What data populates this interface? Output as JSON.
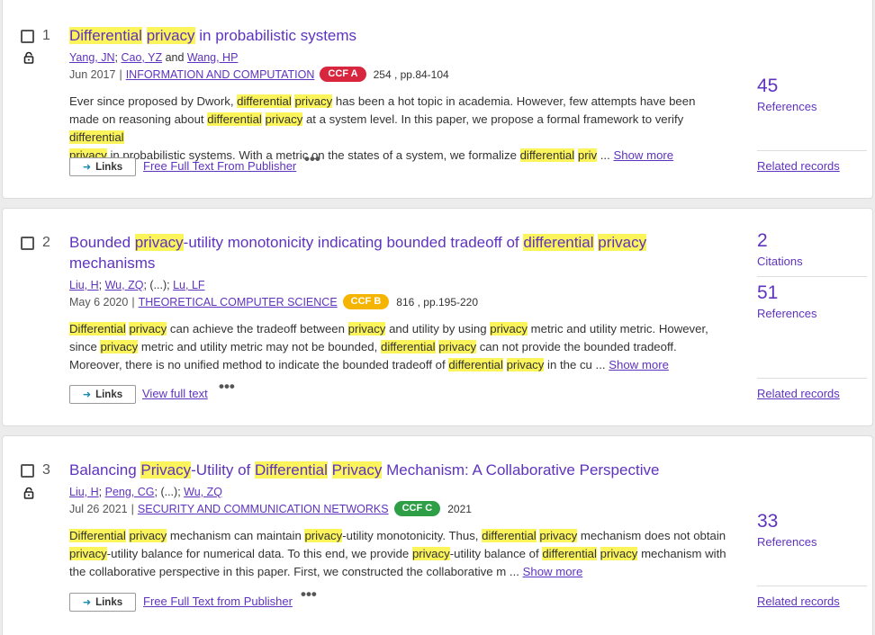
{
  "results": [
    {
      "index": "1",
      "title_parts": [
        "Differential",
        " ",
        "privacy",
        " in probabilistic systems"
      ],
      "authors": [
        "Yang, JN",
        "Cao, YZ",
        "Wang, HP"
      ],
      "author_sep1": ";",
      "author_and": "and",
      "date": "Jun 2017",
      "journal": "INFORMATION AND COMPUTATION",
      "ccf": "CCF A",
      "ccf_color": "#d7263d",
      "volume": "254 , pp.84-104",
      "abstract_parts": [
        "Ever since proposed by Dwork, ",
        "differential",
        " ",
        "privacy",
        " has been a hot topic in academia. However, few attempts have been made on reasoning about ",
        "differential",
        " ",
        "privacy",
        " at a system level. In this paper, we propose a formal framework to verify ",
        "differential",
        " ",
        "privacy",
        " in probabilistic systems. With a metric on the states of a system, we formalize ",
        "differential",
        " ",
        "priv",
        " ... "
      ],
      "show_more": "Show more",
      "links_label": "Links",
      "fulltext": "Free Full Text From Publisher",
      "stats": [
        {
          "num": "45",
          "label": "References"
        }
      ],
      "related": "Related records",
      "locked": true
    },
    {
      "index": "2",
      "title_parts": [
        "Bounded ",
        "privacy",
        "-utility monotonicity indicating bounded tradeoff of ",
        "differential",
        " ",
        "privacy",
        " mechanisms"
      ],
      "authors": [
        "Liu, H",
        "Wu, ZQ",
        "Lu, LF"
      ],
      "author_mid": "; (...);",
      "date": "May 6 2020",
      "journal": "THEORETICAL COMPUTER SCIENCE",
      "ccf": "CCF B",
      "ccf_color": "#f5b400",
      "volume": "816 , pp.195-220",
      "abstract_parts": [
        "Differential",
        " ",
        "privacy",
        " can achieve the tradeoff between ",
        "privacy",
        " and utility by using ",
        "privacy",
        " metric and utility metric. However, since ",
        "privacy",
        " metric and utility metric may not be bounded, ",
        "differential",
        " ",
        "privacy",
        " can not provide the bounded tradeoff. Moreover, there is no unified method to indicate the bounded tradeoff of ",
        "differential",
        " ",
        "privacy",
        " in the cu ... "
      ],
      "show_more": "Show more",
      "links_label": "Links",
      "fulltext": "View full text",
      "stats": [
        {
          "num": "2",
          "label": "Citations"
        },
        {
          "num": "51",
          "label": "References"
        }
      ],
      "related": "Related records",
      "locked": false
    },
    {
      "index": "3",
      "title_parts": [
        "Balancing ",
        "Privacy",
        "-Utility of ",
        "Differential",
        " ",
        "Privacy",
        " Mechanism: A Collaborative Perspective"
      ],
      "authors": [
        "Liu, H",
        "Peng, CG",
        "Wu, ZQ"
      ],
      "author_mid": "; (...);",
      "date": "Jul 26 2021",
      "journal": "SECURITY AND COMMUNICATION NETWORKS",
      "ccf": "CCF C",
      "ccf_color": "#2e9e47",
      "volume": "2021",
      "abstract_parts": [
        "Differential",
        " ",
        "privacy",
        " mechanism can maintain ",
        "privacy",
        "-utility monotonicity. Thus, ",
        "differential",
        " ",
        "privacy",
        " mechanism does not obtain ",
        "privacy",
        "-utility balance for numerical data. To this end, we provide ",
        "privacy",
        "-utility balance of ",
        "differential",
        " ",
        "privacy",
        " mechanism with the collaborative perspective in this paper. First, we constructed the collaborative m ... "
      ],
      "show_more": "Show more",
      "links_label": "Links",
      "fulltext": "Free Full Text from Publisher",
      "stats": [
        {
          "num": "33",
          "label": "References"
        }
      ],
      "related": "Related records",
      "locked": true
    }
  ],
  "icons": {
    "lock": "lock-icon",
    "links_arrow": "arrow-right-icon",
    "more": "more-options-icon"
  },
  "colors": {
    "accent": "#5e33bf",
    "highlight": "#fbf45a"
  }
}
